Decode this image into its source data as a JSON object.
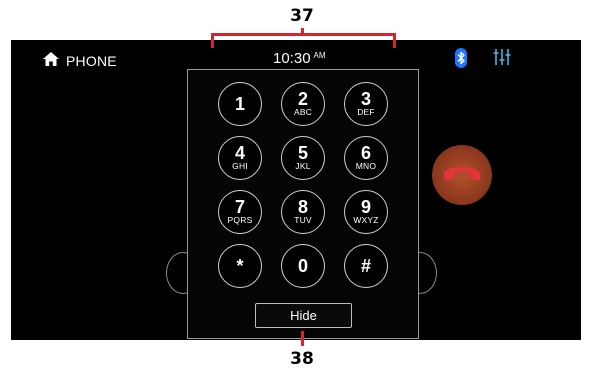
{
  "callouts": {
    "top": "37",
    "bottom": "38"
  },
  "status_bar": {
    "home_label": "PHONE",
    "time": "10:30",
    "ampm": "AM",
    "icons": [
      "home-icon",
      "bluetooth-icon",
      "equalizer-icon"
    ]
  },
  "keypad": {
    "keys": [
      {
        "num": "1",
        "letters": ""
      },
      {
        "num": "2",
        "letters": "ABC"
      },
      {
        "num": "3",
        "letters": "DEF"
      },
      {
        "num": "4",
        "letters": "GHI"
      },
      {
        "num": "5",
        "letters": "JKL"
      },
      {
        "num": "6",
        "letters": "MNO"
      },
      {
        "num": "7",
        "letters": "PQRS"
      },
      {
        "num": "8",
        "letters": "TUV"
      },
      {
        "num": "9",
        "letters": "WXYZ"
      },
      {
        "num": "*",
        "letters": ""
      },
      {
        "num": "0",
        "letters": ""
      },
      {
        "num": "#",
        "letters": ""
      }
    ],
    "hide_label": "Hide"
  },
  "colors": {
    "accent_bluetooth": "#1e78ff",
    "accent_eq": "#3fb6e0",
    "callout_red": "#d8242c",
    "hangup_bg": "#8e3a1f",
    "hangup_icon": "#e2353a"
  }
}
